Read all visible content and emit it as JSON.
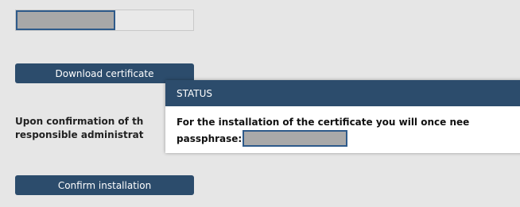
{
  "progress": {
    "fraction": 0.56
  },
  "buttons": {
    "download": "Download certificate",
    "confirm": "Confirm installation"
  },
  "info": {
    "line1": "Upon confirmation of th",
    "line2": "responsible administrat"
  },
  "status_dialog": {
    "title": "STATUS",
    "message_line1": "For the installation of the certificate you will once nee",
    "passphrase_label": "passphrase:",
    "passphrase_value": ""
  },
  "colors": {
    "accent": "#2c4c6c",
    "background": "#e6e6e6",
    "focus_border": "#2e5a8a"
  }
}
